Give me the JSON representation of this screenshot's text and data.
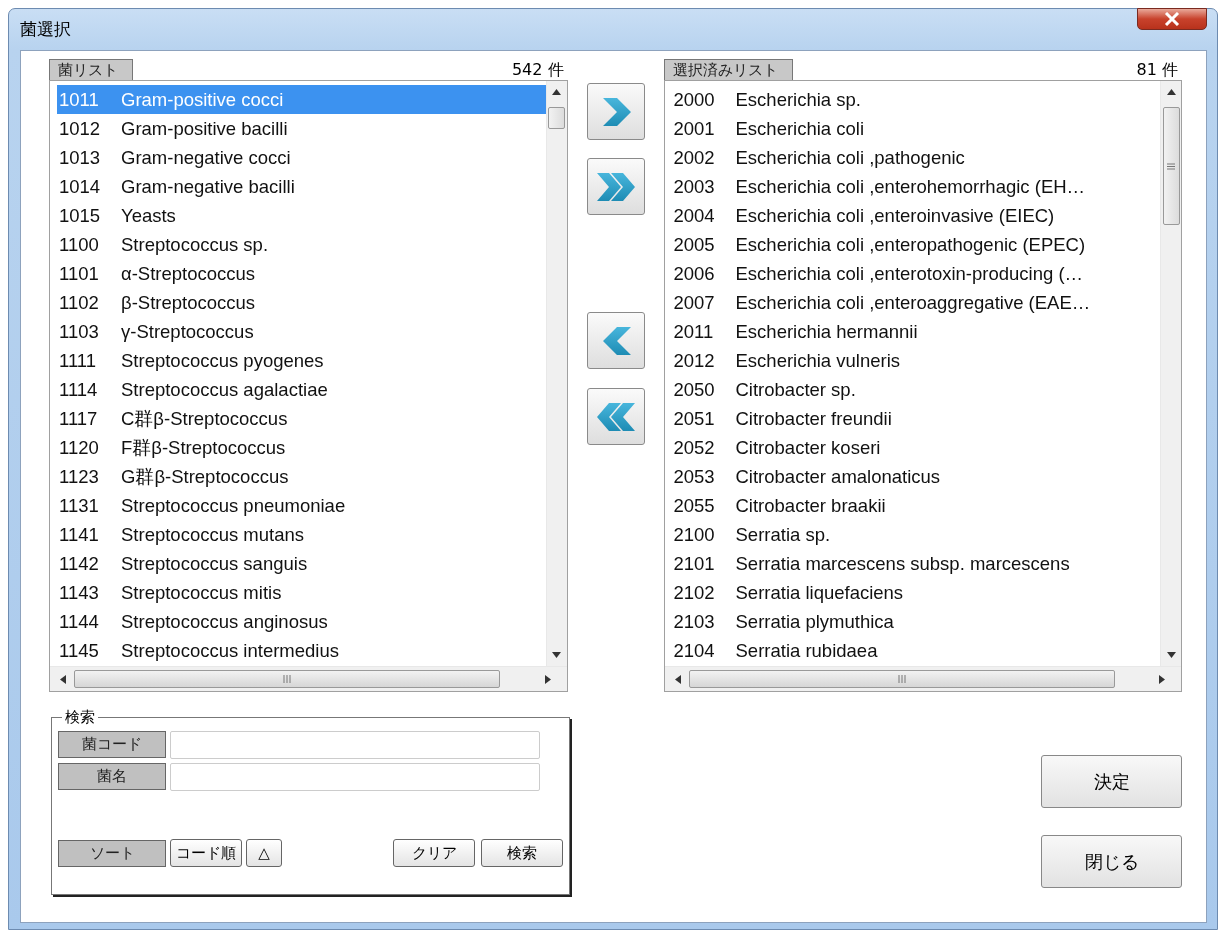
{
  "window": {
    "title": "菌選択"
  },
  "lists": [
    {
      "label": "菌リスト",
      "count": "542 件",
      "items": [
        {
          "code": "1011",
          "name": "Gram-positive cocci",
          "selected": true
        },
        {
          "code": "1012",
          "name": "Gram-positive bacilli",
          "selected": false
        },
        {
          "code": "1013",
          "name": "Gram-negative cocci",
          "selected": false
        },
        {
          "code": "1014",
          "name": "Gram-negative bacilli",
          "selected": false
        },
        {
          "code": "1015",
          "name": "Yeasts",
          "selected": false
        },
        {
          "code": "1100",
          "name": "Streptococcus sp.",
          "selected": false
        },
        {
          "code": "1101",
          "name": "α-Streptococcus",
          "selected": false
        },
        {
          "code": "1102",
          "name": "β-Streptococcus",
          "selected": false
        },
        {
          "code": "1103",
          "name": "γ-Streptococcus",
          "selected": false
        },
        {
          "code": "1111",
          "name": "Streptococcus pyogenes",
          "selected": false
        },
        {
          "code": "1114",
          "name": "Streptococcus agalactiae",
          "selected": false
        },
        {
          "code": "1117",
          "name": "C群β-Streptococcus",
          "selected": false
        },
        {
          "code": "1120",
          "name": "F群β-Streptococcus",
          "selected": false
        },
        {
          "code": "1123",
          "name": "G群β-Streptococcus",
          "selected": false
        },
        {
          "code": "1131",
          "name": "Streptococcus pneumoniae",
          "selected": false
        },
        {
          "code": "1141",
          "name": "Streptococcus mutans",
          "selected": false
        },
        {
          "code": "1142",
          "name": "Streptococcus sanguis",
          "selected": false
        },
        {
          "code": "1143",
          "name": "Streptococcus mitis",
          "selected": false
        },
        {
          "code": "1144",
          "name": "Streptococcus anginosus",
          "selected": false
        },
        {
          "code": "1145",
          "name": "Streptococcus intermedius",
          "selected": false
        }
      ]
    },
    {
      "label": "選択済みリスト",
      "count": "81 件",
      "items": [
        {
          "code": "2000",
          "name": "Escherichia sp.",
          "selected": false
        },
        {
          "code": "2001",
          "name": "Escherichia coli",
          "selected": false
        },
        {
          "code": "2002",
          "name": "Escherichia coli ,pathogenic",
          "selected": false
        },
        {
          "code": "2003",
          "name": "Escherichia coli ,enterohemorrhagic (EH…",
          "selected": false
        },
        {
          "code": "2004",
          "name": "Escherichia coli ,enteroinvasive (EIEC)",
          "selected": false
        },
        {
          "code": "2005",
          "name": "Escherichia coli ,enteropathogenic (EPEC)",
          "selected": false
        },
        {
          "code": "2006",
          "name": "Escherichia coli ,enterotoxin-producing (…",
          "selected": false
        },
        {
          "code": "2007",
          "name": "Escherichia coli ,enteroaggregative (EAE…",
          "selected": false
        },
        {
          "code": "2011",
          "name": "Escherichia hermannii",
          "selected": false
        },
        {
          "code": "2012",
          "name": "Escherichia vulneris",
          "selected": false
        },
        {
          "code": "2050",
          "name": "Citrobacter sp.",
          "selected": false
        },
        {
          "code": "2051",
          "name": "Citrobacter freundii",
          "selected": false
        },
        {
          "code": "2052",
          "name": "Citrobacter koseri",
          "selected": false
        },
        {
          "code": "2053",
          "name": "Citrobacter amalonaticus",
          "selected": false
        },
        {
          "code": "2055",
          "name": "Citrobacter braakii",
          "selected": false
        },
        {
          "code": "2100",
          "name": "Serratia sp.",
          "selected": false
        },
        {
          "code": "2101",
          "name": "Serratia marcescens subsp. marcescens",
          "selected": false
        },
        {
          "code": "2102",
          "name": "Serratia liquefaciens",
          "selected": false
        },
        {
          "code": "2103",
          "name": "Serratia plymuthica",
          "selected": false
        },
        {
          "code": "2104",
          "name": "Serratia rubidaea",
          "selected": false
        }
      ]
    }
  ],
  "search": {
    "title": "検索",
    "fields": [
      {
        "label": "菌コード"
      },
      {
        "label": "菌名"
      }
    ],
    "sort_label": "ソート",
    "sort_order": "コード順",
    "sort_direction": "△",
    "clear": "クリア",
    "search": "検索"
  },
  "actions": [
    "決定",
    "閉じる"
  ]
}
